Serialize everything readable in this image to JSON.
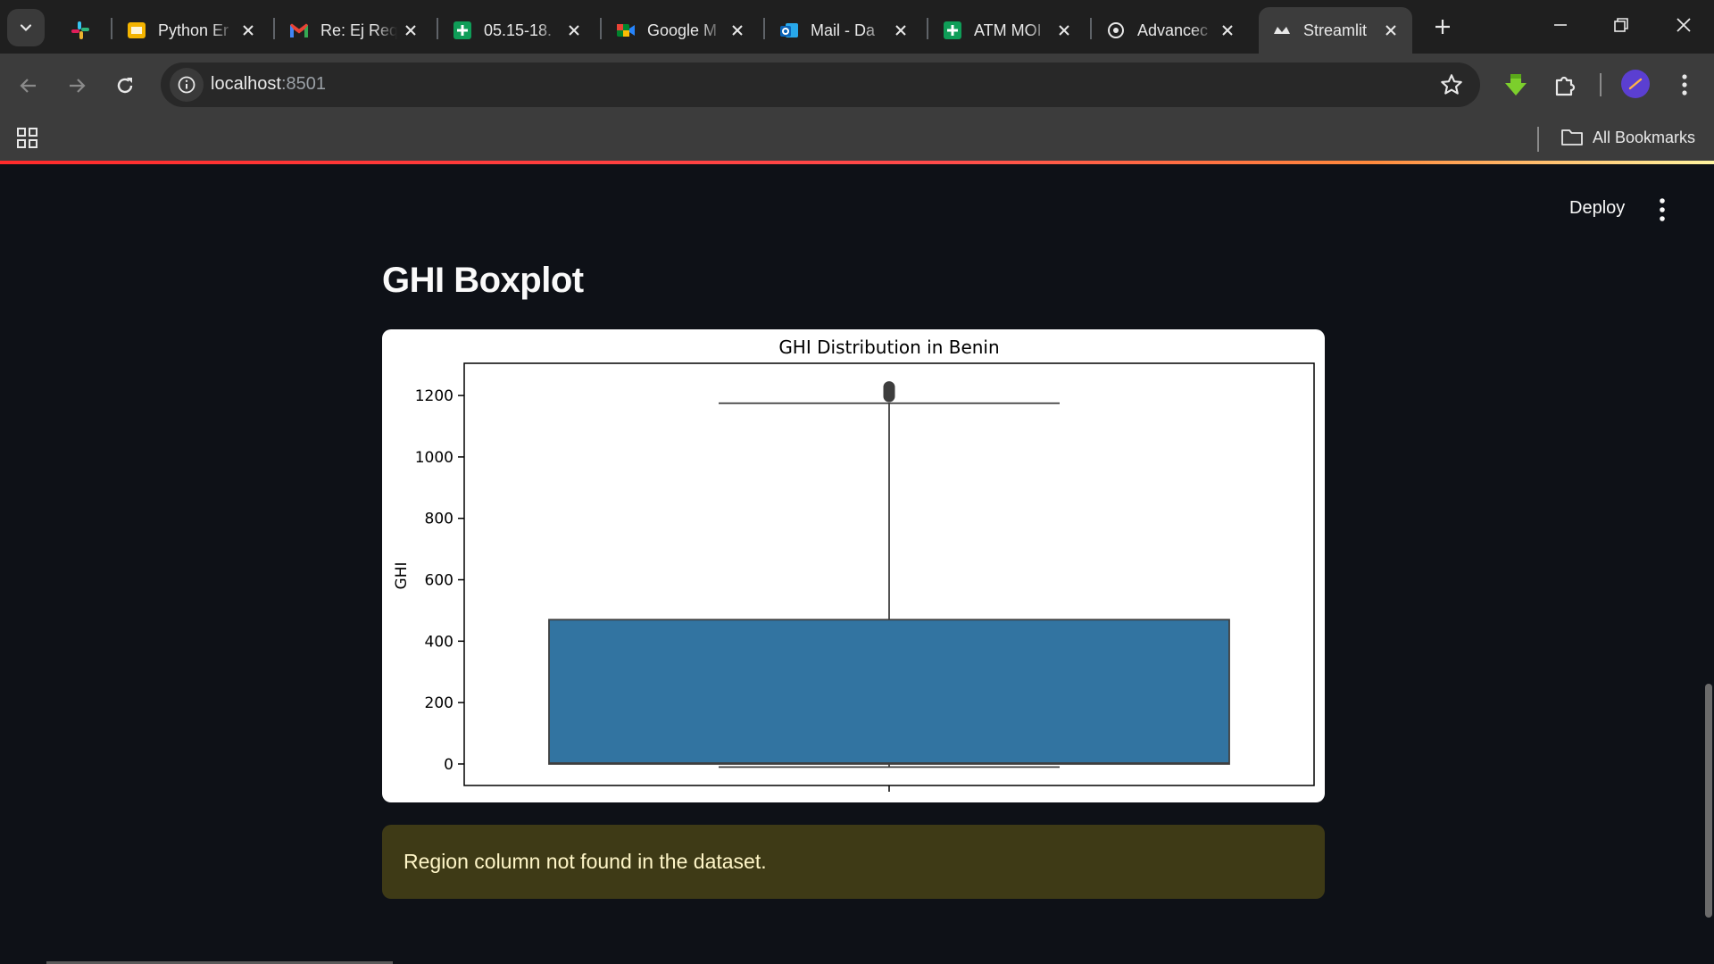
{
  "browser": {
    "tabs": [
      {
        "title": "",
        "icon": "slack-icon",
        "active": false
      },
      {
        "title": "Python Er",
        "icon": "slides-icon",
        "active": false
      },
      {
        "title": "Re: Ej Req",
        "icon": "gmail-icon",
        "active": false
      },
      {
        "title": "05.15-18.",
        "icon": "sheets-icon",
        "active": false
      },
      {
        "title": "Google M",
        "icon": "meet-icon",
        "active": false
      },
      {
        "title": "Mail - Da",
        "icon": "outlook-icon",
        "active": false
      },
      {
        "title": "ATM MOI",
        "icon": "sheets-icon",
        "active": false
      },
      {
        "title": "Advancec",
        "icon": "chatgpt-icon",
        "active": false
      },
      {
        "title": "Streamlit",
        "icon": "streamlit-icon",
        "active": true
      }
    ],
    "url_host": "localhost",
    "url_port": ":8501",
    "bookmarks_label": "All Bookmarks"
  },
  "app": {
    "deploy_label": "Deploy",
    "page_title": "GHI Boxplot",
    "warning": "Region column not found in the dataset."
  },
  "colors": {
    "app_bg": "#0e1117",
    "box_fill": "#3274a1",
    "warning_bg": "#3e3a16",
    "warning_text": "#fff6c8"
  },
  "chart_data": {
    "type": "box",
    "title": "GHI Distribution in Benin",
    "ylabel": "GHI",
    "xlabel": "",
    "ylim": [
      -70,
      1305
    ],
    "yticks": [
      0,
      200,
      400,
      600,
      800,
      1000,
      1200
    ],
    "series": [
      {
        "whisker_low": -10,
        "q1": 0,
        "q3": 470,
        "whisker_high": 1175,
        "outliers_min": 1180,
        "outliers_max": 1245
      }
    ],
    "grid": false,
    "legend": "none"
  }
}
